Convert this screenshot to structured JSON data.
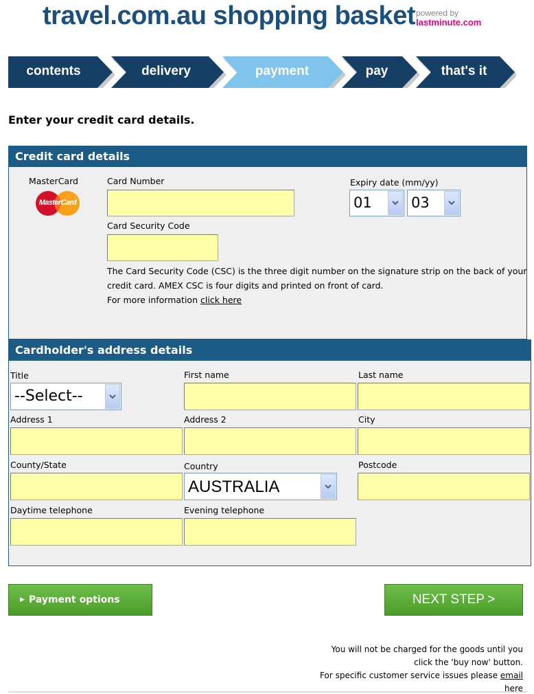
{
  "header": {
    "title": "travel.com.au shopping basket",
    "powered_by": "powered by",
    "partner": "lastminute.com"
  },
  "steps": [
    {
      "label": "contents",
      "state": "done"
    },
    {
      "label": "delivery",
      "state": "done"
    },
    {
      "label": "payment",
      "state": "current"
    },
    {
      "label": "pay",
      "state": "upcoming"
    },
    {
      "label": "that's it",
      "state": "upcoming"
    }
  ],
  "colors": {
    "brand_blue": "#1b4f7c",
    "step_dark": "#163f66",
    "step_current": "#7ec4ec",
    "panel_head": "#1b5b85",
    "field_yellow": "#ffffa8",
    "button_green": "#4a9c2a",
    "partner_pink": "#e6007e"
  },
  "instruction": "Enter your credit card details.",
  "credit_card": {
    "heading": "Credit card details",
    "card_type": "MasterCard",
    "logo_text": "MasterCard",
    "card_number_label": "Card Number",
    "card_number_value": "",
    "expiry_label": "Expiry date (mm/yy)",
    "expiry_month": "01",
    "expiry_year": "03",
    "csc_label": "Card Security Code",
    "csc_value": "",
    "csc_help": "The Card Security Code (CSC) is the three digit number on the signature strip on the back of your credit card. AMEX CSC is four digits and printed on front of card.",
    "more_info": "For more information",
    "more_info_link": "click here"
  },
  "address": {
    "heading": "Cardholder's address details",
    "title_label": "Title",
    "title_value": "--Select--",
    "first_name_label": "First name",
    "last_name_label": "Last name",
    "address1_label": "Address 1",
    "address2_label": "Address 2",
    "city_label": "City",
    "county_label": "County/State",
    "country_label": "Country",
    "country_value": "AUSTRALIA",
    "postcode_label": "Postcode",
    "day_phone_label": "Daytime telephone",
    "eve_phone_label": "Evening telephone"
  },
  "buttons": {
    "payment_options": "Payment options",
    "next_step": "NEXT STEP"
  },
  "footer": {
    "line1": "You will not be charged for the goods until you",
    "line2": "click the 'buy now' button.",
    "line3": "For specific customer service issues please",
    "email_link": "email",
    "line4": "here"
  }
}
